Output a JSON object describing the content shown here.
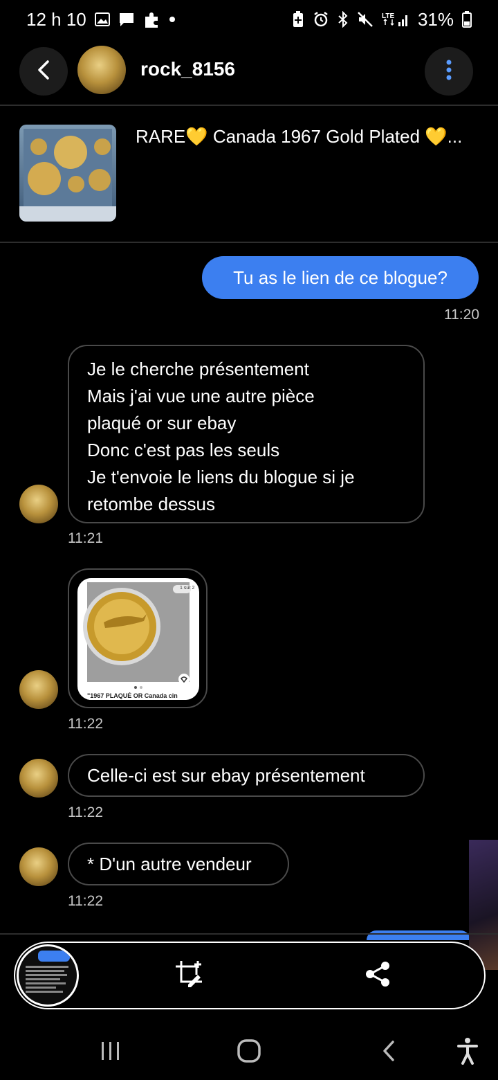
{
  "status_bar": {
    "time": "12 h 10",
    "battery": "31%"
  },
  "header": {
    "username": "rock_8156"
  },
  "listing": {
    "title": "RARE💛 Canada 1967 Gold Plated 💛..."
  },
  "messages": [
    {
      "direction": "sent",
      "text": "Tu as le lien de ce blogue?",
      "time": "11:20"
    },
    {
      "direction": "received",
      "lines": [
        "Je le cherche présentement",
        "Mais j'ai vue une autre pièce",
        "plaqué or sur ebay",
        "Donc c'est pas les seuls",
        "Je t'envoie le liens du blogue si je",
        "retombe dessus"
      ],
      "time": "11:21"
    },
    {
      "direction": "received",
      "type": "image",
      "image_caption": "\"1967 PLAQUÉ OR Canada cin",
      "image_badge": "1 sur 2",
      "time": "11:22"
    },
    {
      "direction": "received",
      "text": "Celle-ci est sur ebay présentement",
      "time": "11:22"
    },
    {
      "direction": "received",
      "text": "* D'un autre vendeur",
      "time": "11:22"
    }
  ],
  "colors": {
    "sent_bubble": "#3c7ff0",
    "menu_dots": "#5a9cff",
    "background": "#000000"
  },
  "icons": [
    "back-arrow-icon",
    "more-vertical-icon",
    "crop-edit-icon",
    "share-icon",
    "recents-icon",
    "home-icon",
    "nav-back-icon",
    "accessibility-icon"
  ]
}
